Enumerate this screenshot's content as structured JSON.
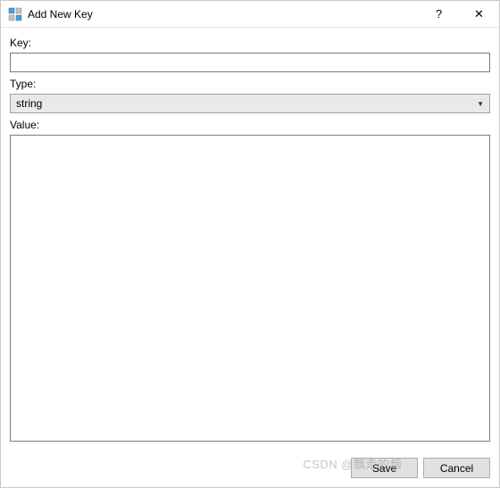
{
  "window": {
    "title": "Add New Key"
  },
  "titlebar": {
    "help": "?",
    "close": "✕"
  },
  "form": {
    "key_label": "Key:",
    "key_value": "",
    "type_label": "Type:",
    "type_value": "string",
    "value_label": "Value:",
    "value_value": ""
  },
  "buttons": {
    "save": "Save",
    "cancel": "Cancel"
  },
  "watermark": "CSDN @飘走的烟"
}
